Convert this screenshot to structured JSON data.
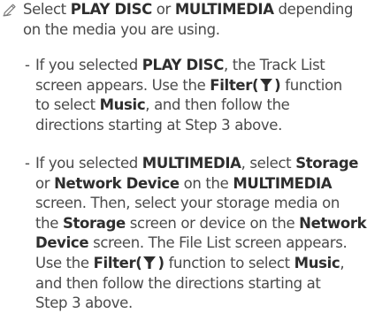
{
  "note": {
    "icon": "pencil-note-icon",
    "lines": [
      {
        "parts": [
          {
            "t": "Select "
          },
          {
            "b": "PLAY DISC"
          },
          {
            "t": " or "
          },
          {
            "b": "MULTIMEDIA"
          },
          {
            "t": " depending"
          }
        ]
      },
      {
        "parts": [
          {
            "t": "on the media you are using."
          }
        ]
      }
    ]
  },
  "items": [
    {
      "dash": "-",
      "lines": [
        {
          "parts": [
            {
              "t": "If you selected "
            },
            {
              "b": "PLAY DISC"
            },
            {
              "t": ", the Track List"
            }
          ]
        },
        {
          "parts": [
            {
              "t": "screen appears. Use the "
            },
            {
              "b": "Filter("
            },
            {
              "icon": "filter-icon"
            },
            {
              "b": ")"
            },
            {
              "t": " function"
            }
          ]
        },
        {
          "parts": [
            {
              "t": "to select "
            },
            {
              "b": "Music"
            },
            {
              "t": ", and then follow the"
            }
          ]
        },
        {
          "parts": [
            {
              "t": "directions starting at Step 3 above."
            }
          ]
        }
      ]
    },
    {
      "dash": "-",
      "lines": [
        {
          "parts": [
            {
              "t": "If you selected "
            },
            {
              "b": "MULTIMEDIA"
            },
            {
              "t": ", select "
            },
            {
              "b": "Storage"
            }
          ]
        },
        {
          "parts": [
            {
              "t": "or "
            },
            {
              "b": "Network Device"
            },
            {
              "t": " on the "
            },
            {
              "b": "MULTIMEDIA"
            }
          ]
        },
        {
          "parts": [
            {
              "t": "screen. Then, select your storage media on"
            }
          ]
        },
        {
          "parts": [
            {
              "t": "the "
            },
            {
              "b": "Storage"
            },
            {
              "t": " screen or device on the "
            },
            {
              "b": "Network"
            }
          ]
        },
        {
          "parts": [
            {
              "b": "Device"
            },
            {
              "t": " screen. The File List screen appears."
            }
          ]
        },
        {
          "parts": [
            {
              "t": "Use the "
            },
            {
              "b": "Filter("
            },
            {
              "icon": "filter-icon"
            },
            {
              "b": ")"
            },
            {
              "t": " function to select "
            },
            {
              "b": "Music"
            },
            {
              "t": ","
            }
          ]
        },
        {
          "parts": [
            {
              "t": "and then follow the directions starting at"
            }
          ]
        },
        {
          "parts": [
            {
              "t": "Step 3 above."
            }
          ]
        }
      ]
    }
  ]
}
